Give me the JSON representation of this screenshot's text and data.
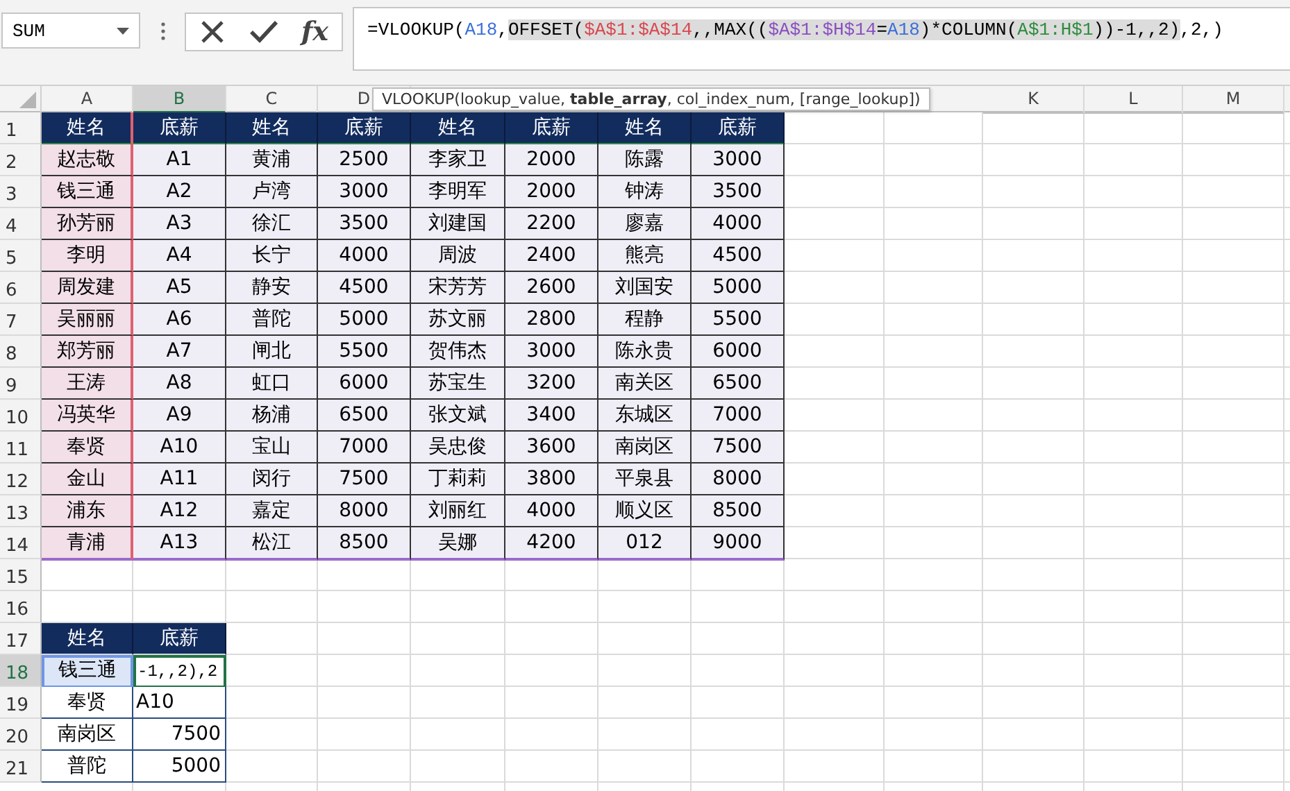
{
  "name_box": {
    "value": "SUM"
  },
  "formula_bar": {
    "function_button": "fx",
    "segments": [
      {
        "text": "=VLOOKUP(",
        "color": "#000000",
        "highlighted": false
      },
      {
        "text": "A18",
        "color": "#3b6fd8",
        "highlighted": false
      },
      {
        "text": ",",
        "color": "#000000",
        "highlighted": false
      },
      {
        "text": "OFFSET(",
        "color": "#000000",
        "highlighted": true
      },
      {
        "text": "$A$1:$A$14",
        "color": "#d9474f",
        "highlighted": true
      },
      {
        "text": ",,MAX((",
        "color": "#000000",
        "highlighted": true
      },
      {
        "text": "$A$1:$H$14",
        "color": "#8a4fc0",
        "highlighted": true
      },
      {
        "text": "=",
        "color": "#000000",
        "highlighted": true
      },
      {
        "text": "A18",
        "color": "#3b6fd8",
        "highlighted": true
      },
      {
        "text": ")*COLUMN(",
        "color": "#000000",
        "highlighted": true
      },
      {
        "text": "A$1:H$1",
        "color": "#2e8b3e",
        "highlighted": true
      },
      {
        "text": "))-1,,2)",
        "color": "#000000",
        "highlighted": true
      },
      {
        "text": ",2,)",
        "color": "#000000",
        "highlighted": false
      }
    ]
  },
  "tooltip": "VLOOKUP(lookup_value, **table_array**, col_index_num, [range_lookup])",
  "columns": [
    {
      "letter": "A",
      "selected": false
    },
    {
      "letter": "B",
      "selected": true
    },
    {
      "letter": "C",
      "selected": false
    },
    {
      "letter": "D",
      "selected": false
    },
    {
      "letter": "K",
      "selected": false
    },
    {
      "letter": "L",
      "selected": false
    },
    {
      "letter": "M",
      "selected": false
    }
  ],
  "rows": [
    {
      "number": "1",
      "selected": false,
      "cells": [
        {
          "text": "姓名",
          "kind": "header"
        },
        {
          "text": "底薪",
          "kind": "header"
        },
        {
          "text": "姓名",
          "kind": "header"
        },
        {
          "text": "底薪",
          "kind": "header"
        },
        {
          "text": "姓名",
          "kind": "header"
        },
        {
          "text": "底薪",
          "kind": "header"
        },
        {
          "text": "姓名",
          "kind": "header"
        },
        {
          "text": "底薪",
          "kind": "header"
        }
      ]
    },
    {
      "number": "2",
      "selected": false,
      "cells": [
        {
          "text": "赵志敬",
          "kind": "key"
        },
        {
          "text": "A1",
          "kind": "body"
        },
        {
          "text": "黄浦",
          "kind": "body"
        },
        {
          "text": "2500",
          "kind": "body"
        },
        {
          "text": "李家卫",
          "kind": "body"
        },
        {
          "text": "2000",
          "kind": "body"
        },
        {
          "text": "陈露",
          "kind": "body"
        },
        {
          "text": "3000",
          "kind": "body"
        }
      ]
    },
    {
      "number": "3",
      "selected": false,
      "cells": [
        {
          "text": "钱三通",
          "kind": "key"
        },
        {
          "text": "A2",
          "kind": "body"
        },
        {
          "text": "卢湾",
          "kind": "body"
        },
        {
          "text": "3000",
          "kind": "body"
        },
        {
          "text": "李明军",
          "kind": "body"
        },
        {
          "text": "2000",
          "kind": "body"
        },
        {
          "text": "钟涛",
          "kind": "body"
        },
        {
          "text": "3500",
          "kind": "body"
        }
      ]
    },
    {
      "number": "4",
      "selected": false,
      "cells": [
        {
          "text": "孙芳丽",
          "kind": "key"
        },
        {
          "text": "A3",
          "kind": "body"
        },
        {
          "text": "徐汇",
          "kind": "body"
        },
        {
          "text": "3500",
          "kind": "body"
        },
        {
          "text": "刘建国",
          "kind": "body"
        },
        {
          "text": "2200",
          "kind": "body"
        },
        {
          "text": "廖嘉",
          "kind": "body"
        },
        {
          "text": "4000",
          "kind": "body"
        }
      ]
    },
    {
      "number": "5",
      "selected": false,
      "cells": [
        {
          "text": "李明",
          "kind": "key"
        },
        {
          "text": "A4",
          "kind": "body"
        },
        {
          "text": "长宁",
          "kind": "body"
        },
        {
          "text": "4000",
          "kind": "body"
        },
        {
          "text": "周波",
          "kind": "body"
        },
        {
          "text": "2400",
          "kind": "body"
        },
        {
          "text": "熊亮",
          "kind": "body"
        },
        {
          "text": "4500",
          "kind": "body"
        }
      ]
    },
    {
      "number": "6",
      "selected": false,
      "cells": [
        {
          "text": "周发建",
          "kind": "key"
        },
        {
          "text": "A5",
          "kind": "body"
        },
        {
          "text": "静安",
          "kind": "body"
        },
        {
          "text": "4500",
          "kind": "body"
        },
        {
          "text": "宋芳芳",
          "kind": "body"
        },
        {
          "text": "2600",
          "kind": "body"
        },
        {
          "text": "刘国安",
          "kind": "body"
        },
        {
          "text": "5000",
          "kind": "body"
        }
      ]
    },
    {
      "number": "7",
      "selected": false,
      "cells": [
        {
          "text": "吴丽丽",
          "kind": "key"
        },
        {
          "text": "A6",
          "kind": "body"
        },
        {
          "text": "普陀",
          "kind": "body"
        },
        {
          "text": "5000",
          "kind": "body"
        },
        {
          "text": "苏文丽",
          "kind": "body"
        },
        {
          "text": "2800",
          "kind": "body"
        },
        {
          "text": "程静",
          "kind": "body"
        },
        {
          "text": "5500",
          "kind": "body"
        }
      ]
    },
    {
      "number": "8",
      "selected": false,
      "cells": [
        {
          "text": "郑芳丽",
          "kind": "key"
        },
        {
          "text": "A7",
          "kind": "body"
        },
        {
          "text": "闸北",
          "kind": "body"
        },
        {
          "text": "5500",
          "kind": "body"
        },
        {
          "text": "贺伟杰",
          "kind": "body"
        },
        {
          "text": "3000",
          "kind": "body"
        },
        {
          "text": "陈永贵",
          "kind": "body"
        },
        {
          "text": "6000",
          "kind": "body"
        }
      ]
    },
    {
      "number": "9",
      "selected": false,
      "cells": [
        {
          "text": "王涛",
          "kind": "key"
        },
        {
          "text": "A8",
          "kind": "body"
        },
        {
          "text": "虹口",
          "kind": "body"
        },
        {
          "text": "6000",
          "kind": "body"
        },
        {
          "text": "苏宝生",
          "kind": "body"
        },
        {
          "text": "3200",
          "kind": "body"
        },
        {
          "text": "南关区",
          "kind": "body"
        },
        {
          "text": "6500",
          "kind": "body"
        }
      ]
    },
    {
      "number": "10",
      "selected": false,
      "cells": [
        {
          "text": "冯英华",
          "kind": "key"
        },
        {
          "text": "A9",
          "kind": "body"
        },
        {
          "text": "杨浦",
          "kind": "body"
        },
        {
          "text": "6500",
          "kind": "body"
        },
        {
          "text": "张文斌",
          "kind": "body"
        },
        {
          "text": "3400",
          "kind": "body"
        },
        {
          "text": "东城区",
          "kind": "body"
        },
        {
          "text": "7000",
          "kind": "body"
        }
      ]
    },
    {
      "number": "11",
      "selected": false,
      "cells": [
        {
          "text": "奉贤",
          "kind": "key"
        },
        {
          "text": "A10",
          "kind": "body"
        },
        {
          "text": "宝山",
          "kind": "body"
        },
        {
          "text": "7000",
          "kind": "body"
        },
        {
          "text": "吴忠俊",
          "kind": "body"
        },
        {
          "text": "3600",
          "kind": "body"
        },
        {
          "text": "南岗区",
          "kind": "body"
        },
        {
          "text": "7500",
          "kind": "body"
        }
      ]
    },
    {
      "number": "12",
      "selected": false,
      "cells": [
        {
          "text": "金山",
          "kind": "key"
        },
        {
          "text": "A11",
          "kind": "body"
        },
        {
          "text": "闵行",
          "kind": "body"
        },
        {
          "text": "7500",
          "kind": "body"
        },
        {
          "text": "丁莉莉",
          "kind": "body"
        },
        {
          "text": "3800",
          "kind": "body"
        },
        {
          "text": "平泉县",
          "kind": "body"
        },
        {
          "text": "8000",
          "kind": "body"
        }
      ]
    },
    {
      "number": "13",
      "selected": false,
      "cells": [
        {
          "text": "浦东",
          "kind": "key"
        },
        {
          "text": "A12",
          "kind": "body"
        },
        {
          "text": "嘉定",
          "kind": "body"
        },
        {
          "text": "8000",
          "kind": "body"
        },
        {
          "text": "刘丽红",
          "kind": "body"
        },
        {
          "text": "4000",
          "kind": "body"
        },
        {
          "text": "顺义区",
          "kind": "body"
        },
        {
          "text": "8500",
          "kind": "body"
        }
      ]
    },
    {
      "number": "14",
      "selected": false,
      "cells": [
        {
          "text": "青浦",
          "kind": "key"
        },
        {
          "text": "A13",
          "kind": "body"
        },
        {
          "text": "松江",
          "kind": "body"
        },
        {
          "text": "8500",
          "kind": "body"
        },
        {
          "text": "吴娜",
          "kind": "body"
        },
        {
          "text": "4200",
          "kind": "body"
        },
        {
          "text": "012",
          "kind": "body"
        },
        {
          "text": "9000",
          "kind": "body"
        }
      ]
    },
    {
      "number": "15",
      "selected": false,
      "cells": []
    },
    {
      "number": "16",
      "selected": false,
      "cells": []
    },
    {
      "number": "17",
      "selected": false,
      "cells": [
        {
          "text": "姓名",
          "kind": "header"
        },
        {
          "text": "底薪",
          "kind": "header"
        }
      ]
    },
    {
      "number": "18",
      "selected": true,
      "cells": [
        {
          "text": "钱三通",
          "kind": "picked"
        },
        {
          "text": "-1,,2),2",
          "kind": "editing"
        }
      ]
    },
    {
      "number": "19",
      "selected": false,
      "cells": [
        {
          "text": "奉贤",
          "kind": "plain"
        },
        {
          "text": "A10",
          "kind": "left"
        }
      ]
    },
    {
      "number": "20",
      "selected": false,
      "cells": [
        {
          "text": "南岗区",
          "kind": "plain"
        },
        {
          "text": "7500",
          "kind": "right"
        }
      ]
    },
    {
      "number": "21",
      "selected": false,
      "cells": [
        {
          "text": "普陀",
          "kind": "plain"
        },
        {
          "text": "5000",
          "kind": "right"
        }
      ]
    }
  ]
}
